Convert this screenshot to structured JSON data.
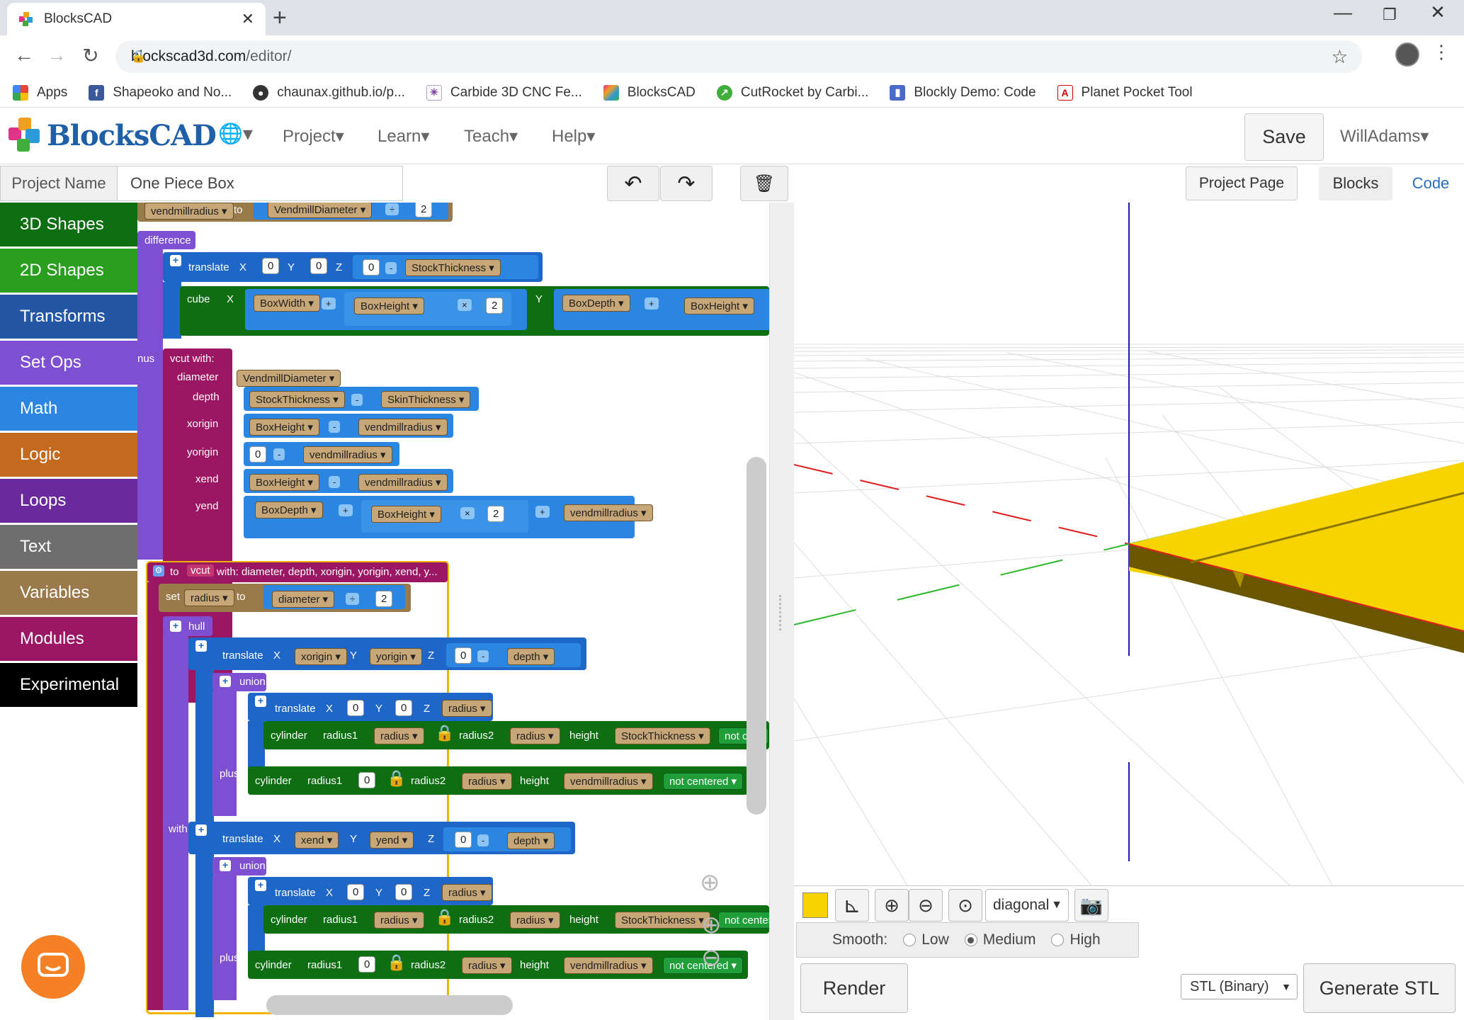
{
  "browser": {
    "tab_title": "BlocksCAD",
    "url_host": "blockscad3d.com",
    "url_path": "/editor/",
    "bookmarks": [
      "Apps",
      "Shapeoko and No...",
      "chaunax.github.io/p...",
      "Carbide 3D CNC Fe...",
      "BlocksCAD",
      "CutRocket by Carbi...",
      "Blockly Demo: Code",
      "Planet Pocket Tool"
    ]
  },
  "app": {
    "logo": "BlocksCAD",
    "menus": [
      "Project",
      "Learn",
      "Teach",
      "Help"
    ],
    "save_label": "Save",
    "user": "WillAdams",
    "project_name_label": "Project Name",
    "project_name_value": "One Piece Box",
    "project_page_label": "Project Page",
    "tab_blocks": "Blocks",
    "tab_code": "Code"
  },
  "categories": [
    {
      "label": "3D Shapes",
      "color": "#0d6e12"
    },
    {
      "label": "2D Shapes",
      "color": "#2a9e1f"
    },
    {
      "label": "Transforms",
      "color": "#2357a6"
    },
    {
      "label": "Set Ops",
      "color": "#7e4fd1"
    },
    {
      "label": "Math",
      "color": "#2a86e0"
    },
    {
      "label": "Logic",
      "color": "#c46a1f"
    },
    {
      "label": "Loops",
      "color": "#6a2a9e"
    },
    {
      "label": "Text",
      "color": "#6e6e6e"
    },
    {
      "label": "Variables",
      "color": "#9a7a4a"
    },
    {
      "label": "Modules",
      "color": "#9c1763"
    },
    {
      "label": "Experimental",
      "color": "#000000"
    }
  ],
  "blocks": {
    "set_vendmill": "vendmillradius",
    "to": "to",
    "vendmill_diameter": "VendmillDiameter",
    "div": "÷",
    "two": "2",
    "difference": "difference",
    "translate": "translate",
    "x": "X",
    "y": "Y",
    "z": "Z",
    "zero": "0",
    "minus": "-",
    "stock_thickness": "StockThickness",
    "cube": "cube",
    "box_width": "BoxWidth",
    "plus_op": "+",
    "box_height": "BoxHeight",
    "times": "×",
    "box_depth": "BoxDepth",
    "nus": "nus",
    "vcut_with": "vcut  with:",
    "diameter": "diameter",
    "depth": "depth",
    "xorigin": "xorigin",
    "yorigin": "yorigin",
    "xend": "xend",
    "yend": "yend",
    "skin_thickness": "SkinThickness",
    "vend_radius": "vendmillradius",
    "def_to": "to",
    "def_name": "vcut",
    "def_params": "with: diameter, depth, xorigin, yorigin, xend, y...",
    "set": "set",
    "radius": "radius",
    "hull": "hull",
    "union": "union",
    "cylinder": "cylinder",
    "radius1": "radius1",
    "radius2": "radius2",
    "height": "height",
    "not_centered": "not centered",
    "not_ce": "not ce",
    "not_center": "not center",
    "plus": "plus",
    "with": "with"
  },
  "viewer": {
    "view_mode": "diagonal",
    "smooth_label": "Smooth:",
    "smooth_options": [
      "Low",
      "Medium",
      "High"
    ],
    "smooth_selected": "Medium",
    "render_label": "Render",
    "export_format": "STL (Binary)",
    "generate_label": "Generate STL",
    "object_color": "#f7d300"
  }
}
